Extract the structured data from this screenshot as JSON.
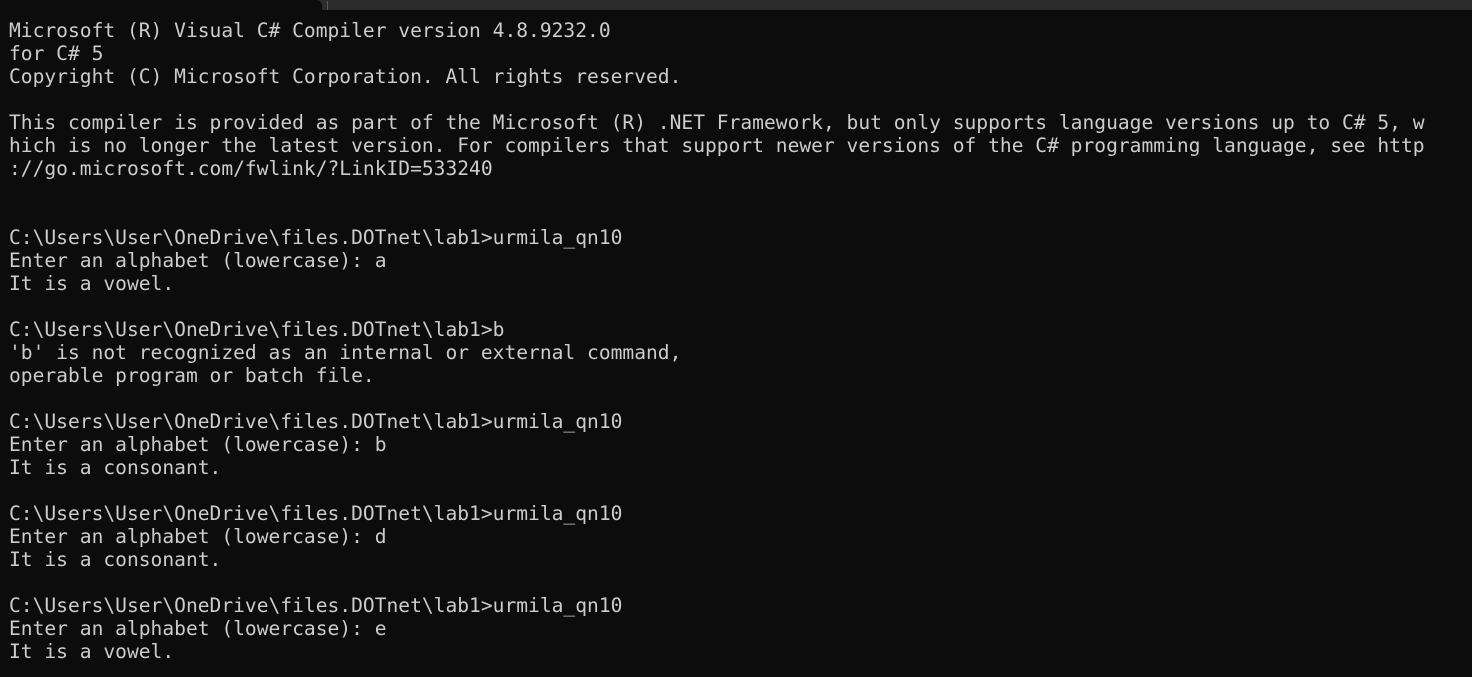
{
  "terminal": {
    "colors": {
      "background": "#0c0c0c",
      "foreground": "#cccccc",
      "tab_bar": "#2b2b2b"
    },
    "lines": [
      "Microsoft (R) Visual C# Compiler version 4.8.9232.0",
      "for C# 5",
      "Copyright (C) Microsoft Corporation. All rights reserved.",
      "",
      "This compiler is provided as part of the Microsoft (R) .NET Framework, but only supports language versions up to C# 5, w",
      "hich is no longer the latest version. For compilers that support newer versions of the C# programming language, see http",
      "://go.microsoft.com/fwlink/?LinkID=533240",
      "",
      "",
      "C:\\Users\\User\\OneDrive\\files.DOTnet\\lab1>urmila_qn10",
      "Enter an alphabet (lowercase): a",
      "It is a vowel.",
      "",
      "C:\\Users\\User\\OneDrive\\files.DOTnet\\lab1>b",
      "'b' is not recognized as an internal or external command,",
      "operable program or batch file.",
      "",
      "C:\\Users\\User\\OneDrive\\files.DOTnet\\lab1>urmila_qn10",
      "Enter an alphabet (lowercase): b",
      "It is a consonant.",
      "",
      "C:\\Users\\User\\OneDrive\\files.DOTnet\\lab1>urmila_qn10",
      "Enter an alphabet (lowercase): d",
      "It is a consonant.",
      "",
      "C:\\Users\\User\\OneDrive\\files.DOTnet\\lab1>urmila_qn10",
      "Enter an alphabet (lowercase): e",
      "It is a vowel."
    ]
  }
}
